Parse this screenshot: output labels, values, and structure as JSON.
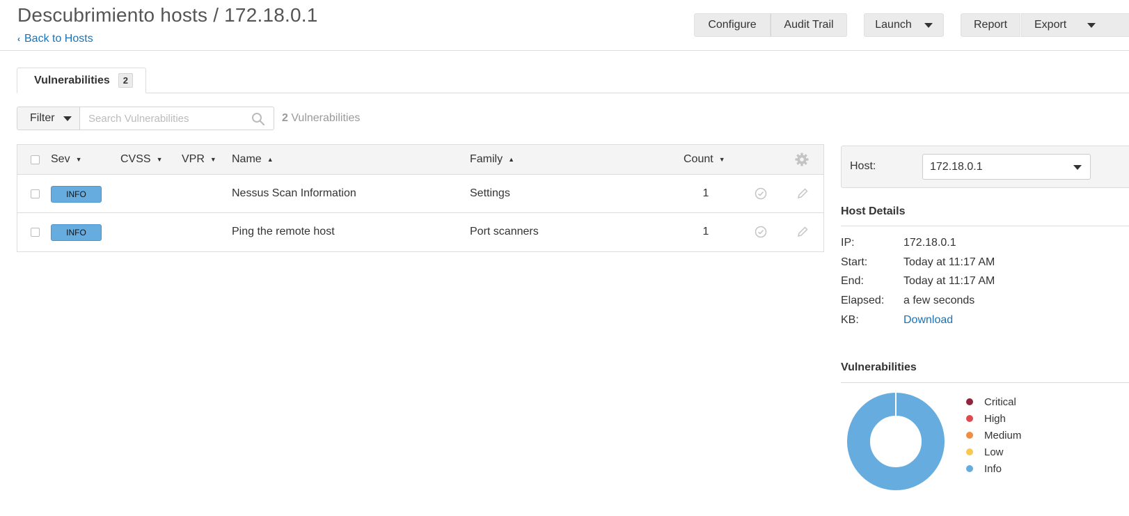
{
  "header": {
    "title": "Descubrimiento hosts / 172.18.0.1",
    "back_link": "Back to Hosts",
    "buttons": {
      "configure": "Configure",
      "audit_trail": "Audit Trail",
      "launch": "Launch",
      "report": "Report",
      "export": "Export"
    }
  },
  "tabs": [
    {
      "label": "Vulnerabilities",
      "badge": "2",
      "active": true
    }
  ],
  "filter": {
    "label": "Filter",
    "search_placeholder": "Search Vulnerabilities",
    "search_value": "",
    "result_count": "2",
    "result_label": " Vulnerabilities"
  },
  "table": {
    "columns": [
      {
        "key": "sev",
        "label": "Sev",
        "sort": "▼"
      },
      {
        "key": "cvss",
        "label": "CVSS",
        "sort": "▼"
      },
      {
        "key": "vpr",
        "label": "VPR",
        "sort": "▼"
      },
      {
        "key": "name",
        "label": "Name",
        "sort": "▲"
      },
      {
        "key": "family",
        "label": "Family",
        "sort": "▲"
      },
      {
        "key": "count",
        "label": "Count",
        "sort": "▼"
      }
    ],
    "rows": [
      {
        "sev": "INFO",
        "cvss": "",
        "vpr": "",
        "name": "Nessus Scan Information",
        "family": "Settings",
        "count": "1"
      },
      {
        "sev": "INFO",
        "cvss": "",
        "vpr": "",
        "name": "Ping the remote host",
        "family": "Port scanners",
        "count": "1"
      }
    ]
  },
  "host_panel": {
    "label": "Host:",
    "selected": "172.18.0.1"
  },
  "host_details": {
    "title": "Host Details",
    "items": [
      {
        "label": "IP:",
        "value": "172.18.0.1"
      },
      {
        "label": "Start:",
        "value": "Today at 11:17 AM"
      },
      {
        "label": "End:",
        "value": "Today at 11:17 AM"
      },
      {
        "label": "Elapsed:",
        "value": "a few seconds"
      },
      {
        "label": "KB:",
        "value": "Download"
      }
    ]
  },
  "vulnerabilities_summary": {
    "title": "Vulnerabilities",
    "legend": [
      {
        "label": "Critical",
        "color": "#91243e"
      },
      {
        "label": "High",
        "color": "#dd4b50"
      },
      {
        "label": "Medium",
        "color": "#f18c43"
      },
      {
        "label": "Low",
        "color": "#f8c851"
      },
      {
        "label": "Info",
        "color": "#67acdf"
      }
    ]
  },
  "chart_data": {
    "type": "pie",
    "categories": [
      "Critical",
      "High",
      "Medium",
      "Low",
      "Info"
    ],
    "values": [
      0,
      0,
      0,
      0,
      2
    ],
    "colors": [
      "#91243e",
      "#dd4b50",
      "#f18c43",
      "#f8c851",
      "#67acdf"
    ],
    "title": "",
    "legend": "right",
    "donut": true
  },
  "colors": {
    "link": "#1a73b8",
    "info_badge": "#67acdf",
    "button_bg": "#ebebeb"
  }
}
